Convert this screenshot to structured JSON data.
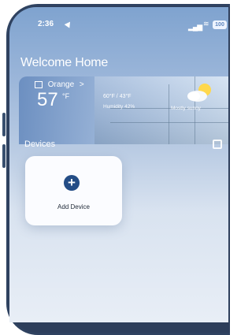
{
  "status_bar": {
    "time": "2:36",
    "battery": "100"
  },
  "home": {
    "title": "Welcome Home"
  },
  "weather": {
    "location": "Orange",
    "location_arrow": ">",
    "temperature": "57",
    "unit": "°F",
    "range": "60°F / 43°F",
    "humidity": "Humidity 42%",
    "condition": "Mostly sunny"
  },
  "devices": {
    "title": "Devices",
    "add_label": "Add Device"
  }
}
